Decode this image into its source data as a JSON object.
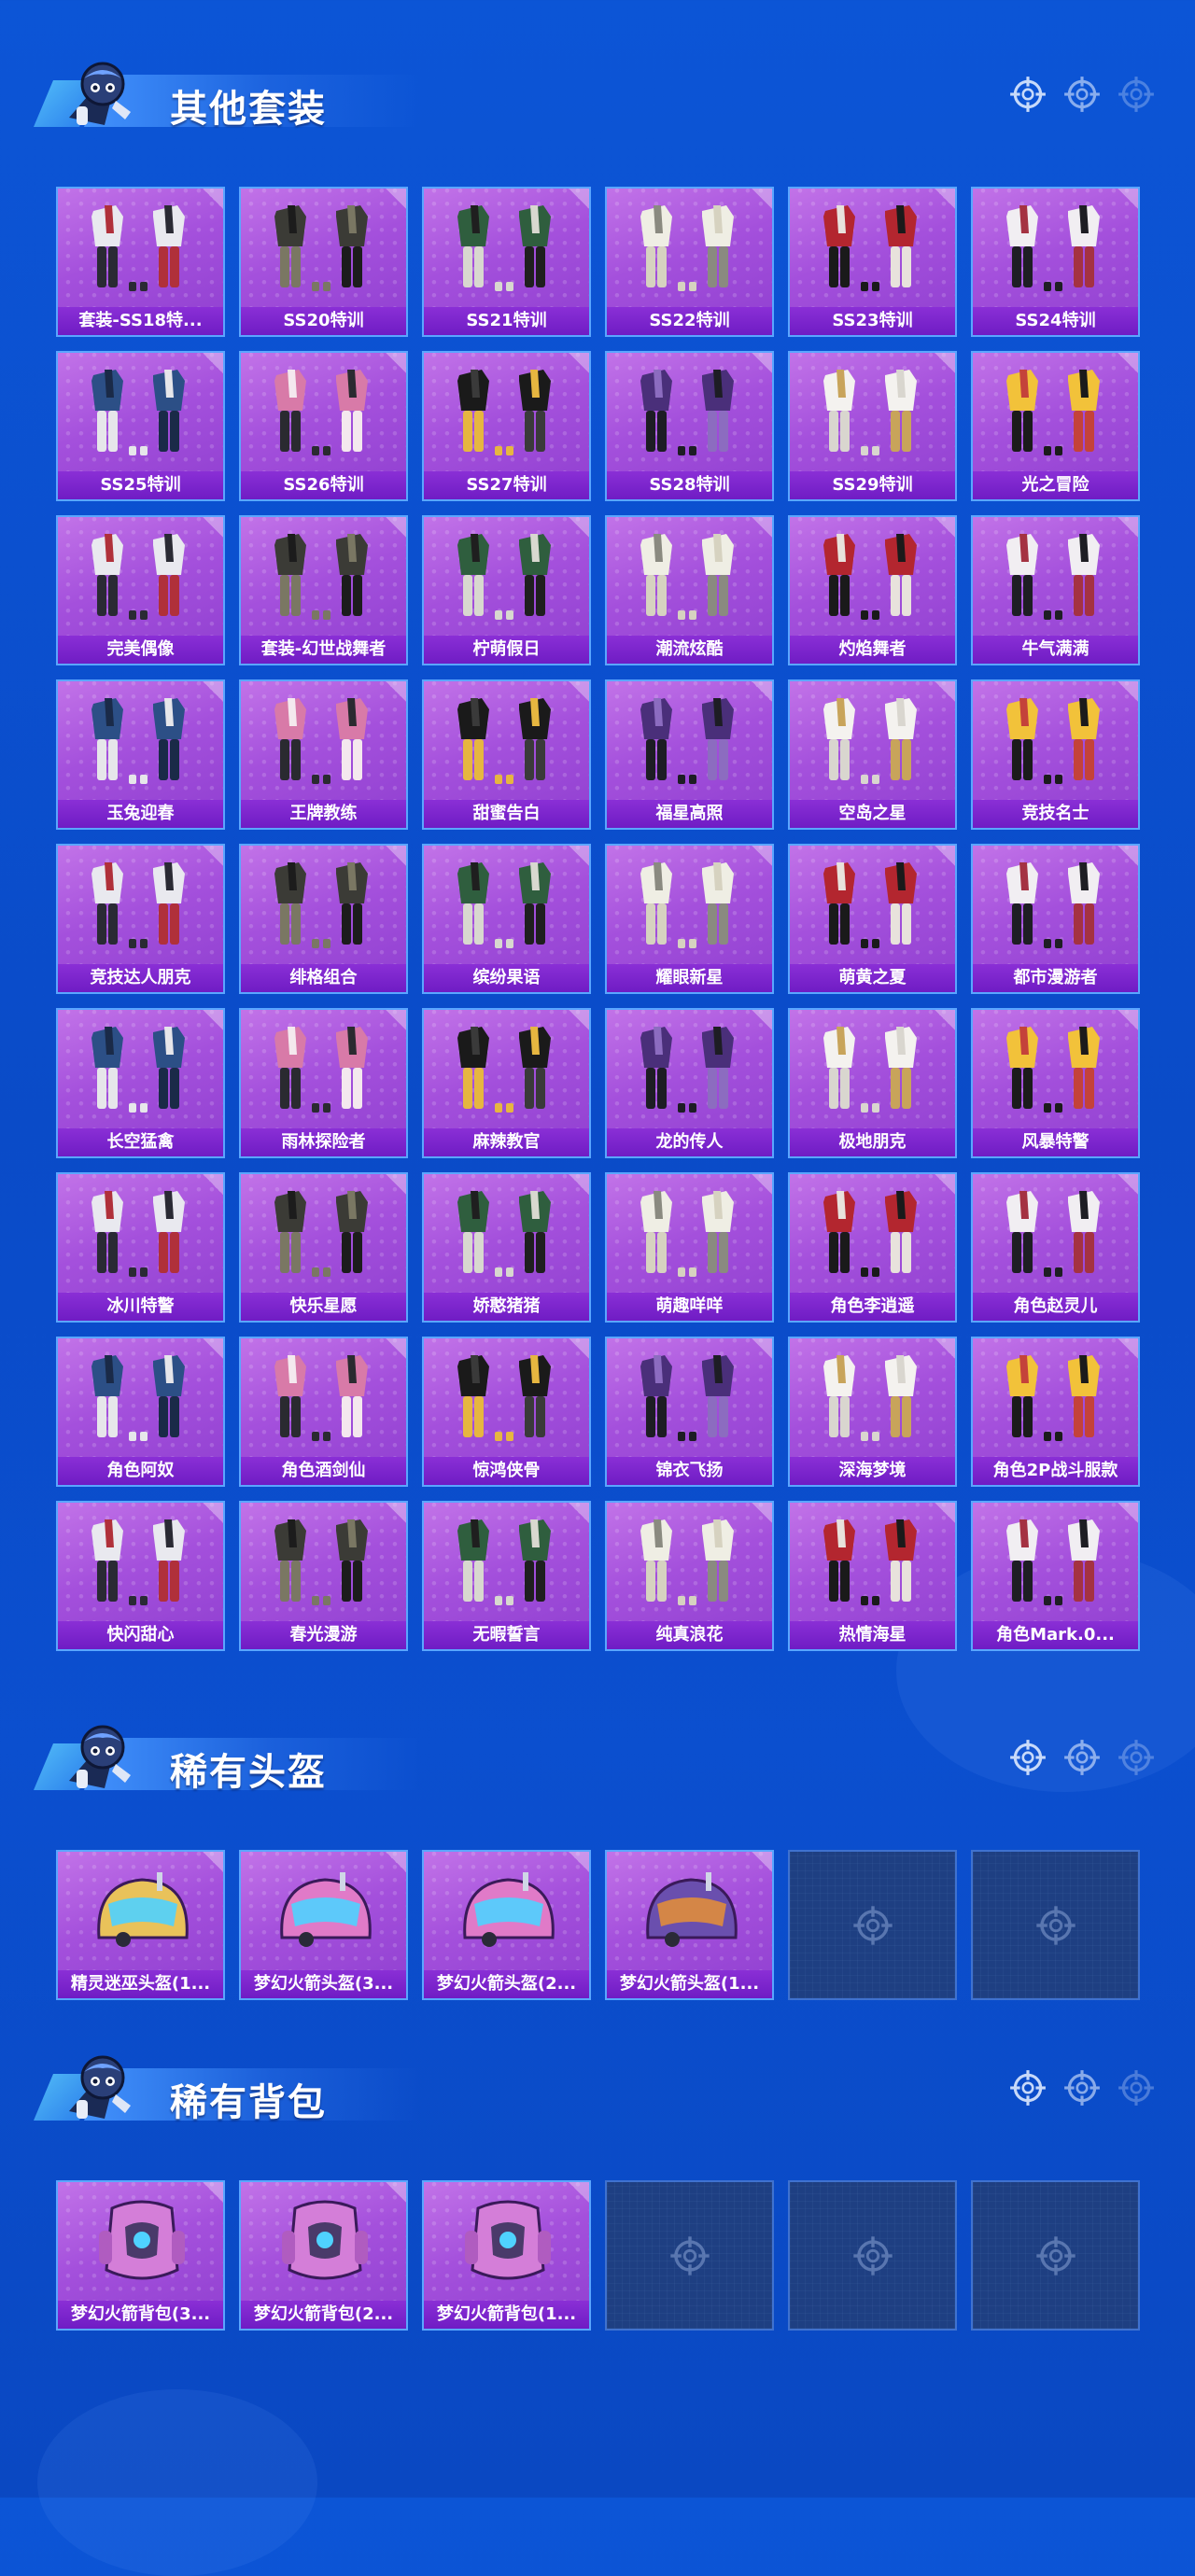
{
  "sections": {
    "outfits": {
      "title": "其他套装",
      "items": [
        "套装-SS18特...",
        "SS20特训",
        "SS21特训",
        "SS22特训",
        "SS23特训",
        "SS24特训",
        "SS25特训",
        "SS26特训",
        "SS27特训",
        "SS28特训",
        "SS29特训",
        "光之冒险",
        "完美偶像",
        "套装-幻世战舞者",
        "柠萌假日",
        "潮流炫酷",
        "灼焰舞者",
        "牛气满满",
        "玉兔迎春",
        "王牌教练",
        "甜蜜告白",
        "福星高照",
        "空岛之星",
        "竞技名士",
        "竞技达人朋克",
        "绯格组合",
        "缤纷果语",
        "耀眼新星",
        "萌黄之夏",
        "都市漫游者",
        "长空猛禽",
        "雨林探险者",
        "麻辣教官",
        "龙的传人",
        "极地朋克",
        "风暴特警",
        "冰川特警",
        "快乐星愿",
        "娇憨猪猪",
        "萌趣咩咩",
        "角色李逍遥",
        "角色赵灵儿",
        "角色阿奴",
        "角色酒剑仙",
        "惊鸿侠骨",
        "锦衣飞扬",
        "深海梦境",
        "角色2P战斗服款",
        "快闪甜心",
        "春光漫游",
        "无暇誓言",
        "纯真浪花",
        "热情海星",
        "角色Mark.0..."
      ]
    },
    "helmets": {
      "title": "稀有头盔",
      "items": [
        "精灵迷巫头盔(1...",
        "梦幻火箭头盔(3...",
        "梦幻火箭头盔(2...",
        "梦幻火箭头盔(1..."
      ]
    },
    "backpacks": {
      "title": "稀有背包",
      "items": [
        "梦幻火箭背包(3...",
        "梦幻火箭背包(2...",
        "梦幻火箭背包(1..."
      ]
    }
  },
  "icons": [
    "mascot-icon",
    "crosshair-icon"
  ],
  "colors": {
    "background": "#0b50d0",
    "card_purple": "#a450dc",
    "caption_purple": "#7a24cc",
    "card_border": "#5aa6ff",
    "empty_slot": "#1e3f82"
  }
}
